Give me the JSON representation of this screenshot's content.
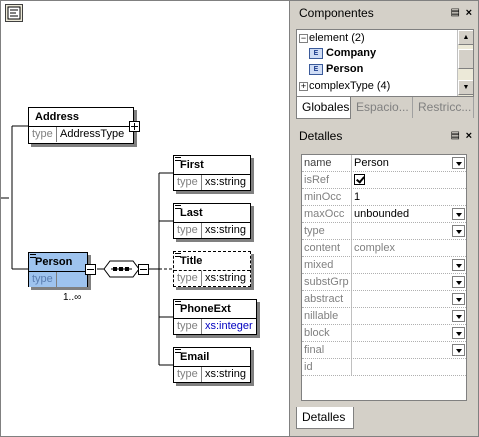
{
  "diagram": {
    "nodes": {
      "address": {
        "name": "Address",
        "type_key": "type",
        "type_value": "AddressType"
      },
      "person": {
        "name": "Person",
        "type_key": "type",
        "occurrence": "1..∞"
      },
      "first": {
        "name": "First",
        "type_key": "type",
        "type_value": "xs:string"
      },
      "last": {
        "name": "Last",
        "type_key": "type",
        "type_value": "xs:string"
      },
      "title": {
        "name": "Title",
        "type_key": "type",
        "type_value": "xs:string"
      },
      "phoneext": {
        "name": "PhoneExt",
        "type_key": "type",
        "type_value": "xs:integer"
      },
      "email": {
        "name": "Email",
        "type_key": "type",
        "type_value": "xs:string"
      }
    }
  },
  "components": {
    "title": "Componentes",
    "pin_icon": "pin-icon",
    "close_icon": "close-icon",
    "tree": [
      {
        "label": "element (2)",
        "expanded": true
      },
      {
        "label": "Company",
        "icon": "E"
      },
      {
        "label": "Person",
        "icon": "E"
      },
      {
        "label": "complexType (4)",
        "expanded": false
      }
    ],
    "tabs": [
      "Globales",
      "Espacio...",
      "Restricc..."
    ]
  },
  "details": {
    "title": "Detalles",
    "rows": [
      {
        "key": "name",
        "value": "Person",
        "dropdown": true
      },
      {
        "key": "isRef",
        "checkbox": true
      },
      {
        "key": "minOcc",
        "value": "1"
      },
      {
        "key": "maxOcc",
        "value": "unbounded",
        "dropdown": true
      },
      {
        "key": "type",
        "value": "",
        "dropdown": true
      },
      {
        "key": "content",
        "value": "complex"
      },
      {
        "key": "mixed",
        "value": "",
        "dropdown": true
      },
      {
        "key": "substGrp",
        "value": "",
        "dropdown": true
      },
      {
        "key": "abstract",
        "value": "",
        "dropdown": true
      },
      {
        "key": "nillable",
        "value": "",
        "dropdown": true
      },
      {
        "key": "block",
        "value": "",
        "dropdown": true
      },
      {
        "key": "final",
        "value": "",
        "dropdown": true
      },
      {
        "key": "id",
        "value": ""
      }
    ],
    "tab": "Detalles"
  }
}
